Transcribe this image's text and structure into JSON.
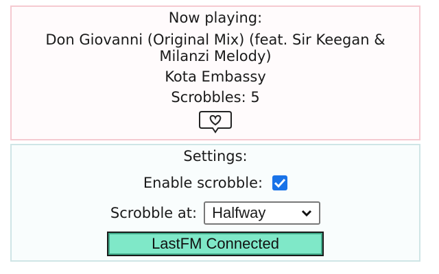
{
  "now_playing": {
    "heading": "Now playing:",
    "track": "Don Giovanni (Original Mix) (feat. Sir Keegan & Milanzi Melody)",
    "artist": "Kota Embassy",
    "scrobbles_text": "Scrobbles: 5",
    "love_icon": "heart-speech-bubble-icon"
  },
  "settings": {
    "heading": "Settings:",
    "enable_label": "Enable scrobble:",
    "enable_checked": true,
    "scrobble_at_label": "Scrobble at:",
    "scrobble_at_value": "Halfway",
    "connect_button_label": "LastFM Connected"
  },
  "colors": {
    "now_playing_border": "#f5c9d0",
    "settings_border": "#cfe5e6",
    "checkbox_accent": "#1a73e8",
    "button_background": "#7fe8c8"
  }
}
